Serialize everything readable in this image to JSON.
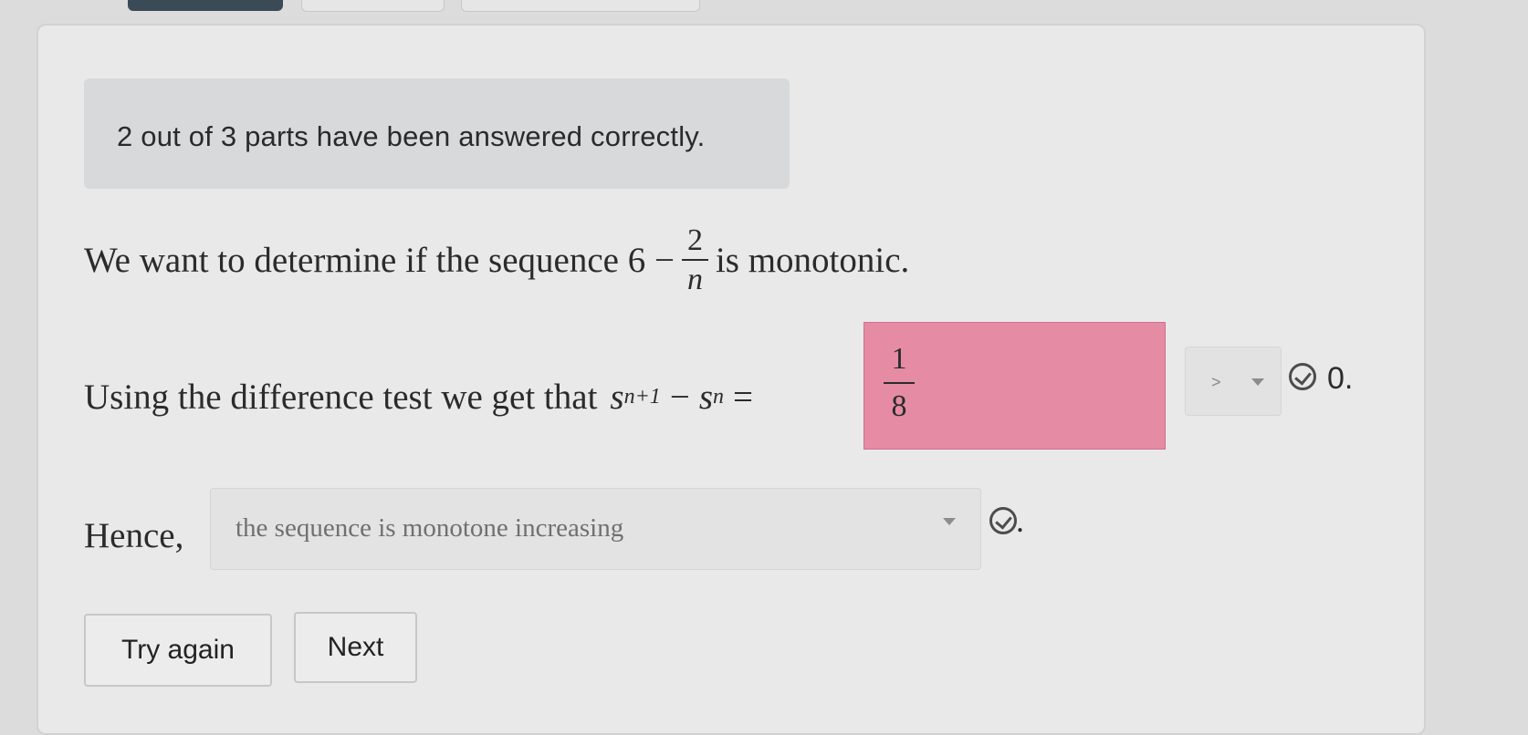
{
  "status": {
    "message": "2 out of 3 parts have been answered correctly."
  },
  "question": {
    "prefix": "We want to determine if the sequence 6 −",
    "frac_num": "2",
    "frac_den": "n",
    "suffix": "is monotonic."
  },
  "difference": {
    "prefix": "Using the difference test we get that",
    "s1": "s",
    "s1_sub": "n+1",
    "minus": "−",
    "s2": "s",
    "s2_sub": "n",
    "equals": "=",
    "answer_num": "1",
    "answer_den": "8",
    "comparison_value": ">",
    "trailing": "0."
  },
  "conclusion": {
    "label": "Hence,",
    "selected": "the sequence is monotone increasing",
    "trailing": "."
  },
  "buttons": {
    "try_again": "Try again",
    "next": "Next"
  },
  "colors": {
    "incorrect_answer_bg": "#e58ca4",
    "status_bg": "#d7d9db"
  },
  "icons": {
    "correct": "check-circle-icon",
    "dropdown": "chevron-down-icon"
  }
}
